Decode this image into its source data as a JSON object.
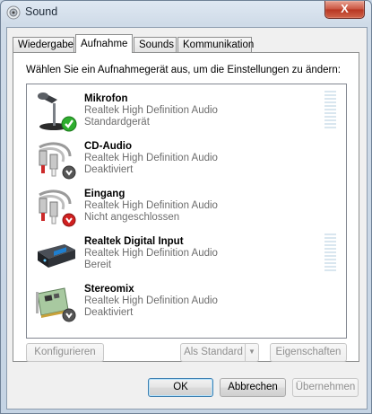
{
  "window": {
    "title": "Sound",
    "close_glyph": "X"
  },
  "tabs": [
    {
      "label": "Wiedergabe",
      "active": false
    },
    {
      "label": "Aufnahme",
      "active": true
    },
    {
      "label": "Sounds",
      "active": false
    },
    {
      "label": "Kommunikation",
      "active": false
    }
  ],
  "instruction": "Wählen Sie ein Aufnahmegerät aus, um die Einstellungen zu ändern:",
  "devices": [
    {
      "name": "Mikrofon",
      "driver": "Realtek High Definition Audio",
      "status": "Standardgerät",
      "icon": "microphone-icon",
      "badge": "default-check"
    },
    {
      "name": "CD-Audio",
      "driver": "Realtek High Definition Audio",
      "status": "Deaktiviert",
      "icon": "rca-cable-icon",
      "badge": "disabled-arrow"
    },
    {
      "name": "Eingang",
      "driver": "Realtek High Definition Audio",
      "status": "Nicht angeschlossen",
      "icon": "rca-cable-icon",
      "badge": "unplugged-arrow"
    },
    {
      "name": "Realtek Digital Input",
      "driver": "Realtek High Definition Audio",
      "status": "Bereit",
      "icon": "digital-input-icon",
      "badge": "none"
    },
    {
      "name": "Stereomix",
      "driver": "Realtek High Definition Audio",
      "status": "Deaktiviert",
      "icon": "sound-card-icon",
      "badge": "disabled-arrow"
    }
  ],
  "buttons": {
    "configure": "Konfigurieren",
    "set_default": "Als Standard",
    "properties": "Eigenschaften",
    "ok": "OK",
    "cancel": "Abbrechen",
    "apply": "Übernehmen"
  },
  "colors": {
    "check_green": "#2eae2e",
    "badge_gray": "#555555",
    "badge_red": "#d02020",
    "meter": "#d9e6ef"
  }
}
